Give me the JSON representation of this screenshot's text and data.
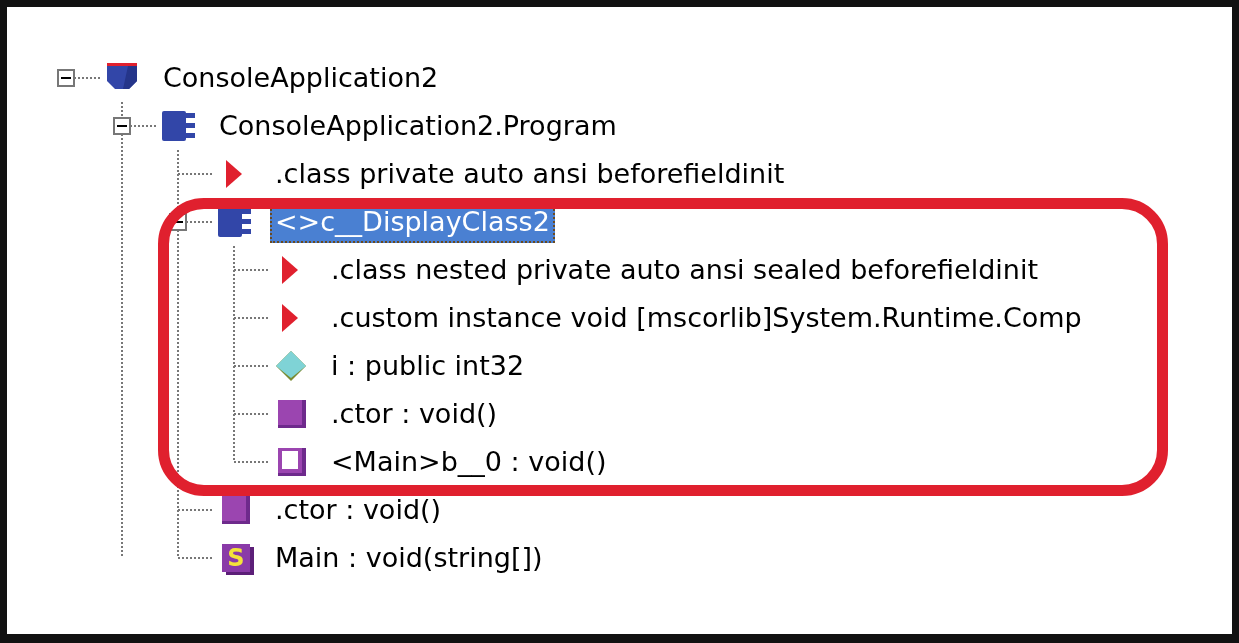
{
  "tree": [
    {
      "label": "ConsoleApplication2",
      "kind": "namespace",
      "expanded": true,
      "selected": false,
      "children": [
        {
          "label": "ConsoleApplication2.Program",
          "kind": "class",
          "expanded": true,
          "selected": false,
          "children": [
            {
              "label": ".class private auto ansi beforefieldinit",
              "kind": "attribute",
              "selected": false
            },
            {
              "label": "<>c__DisplayClass2",
              "kind": "class",
              "expanded": true,
              "selected": true,
              "children": [
                {
                  "label": ".class nested private auto ansi sealed beforefieldinit",
                  "kind": "attribute",
                  "selected": false
                },
                {
                  "label": ".custom instance void [mscorlib]System.Runtime.Comp",
                  "kind": "attribute",
                  "selected": false
                },
                {
                  "label": "i : public int32",
                  "kind": "field",
                  "selected": false
                },
                {
                  "label": ".ctor : void()",
                  "kind": "method",
                  "selected": false
                },
                {
                  "label": "<Main>b__0 : void()",
                  "kind": "hollow-method",
                  "selected": false
                }
              ]
            },
            {
              "label": ".ctor : void()",
              "kind": "method",
              "selected": false
            },
            {
              "label": "Main : void(string[])",
              "kind": "static-method",
              "badge": "S",
              "selected": false
            }
          ]
        }
      ]
    }
  ]
}
